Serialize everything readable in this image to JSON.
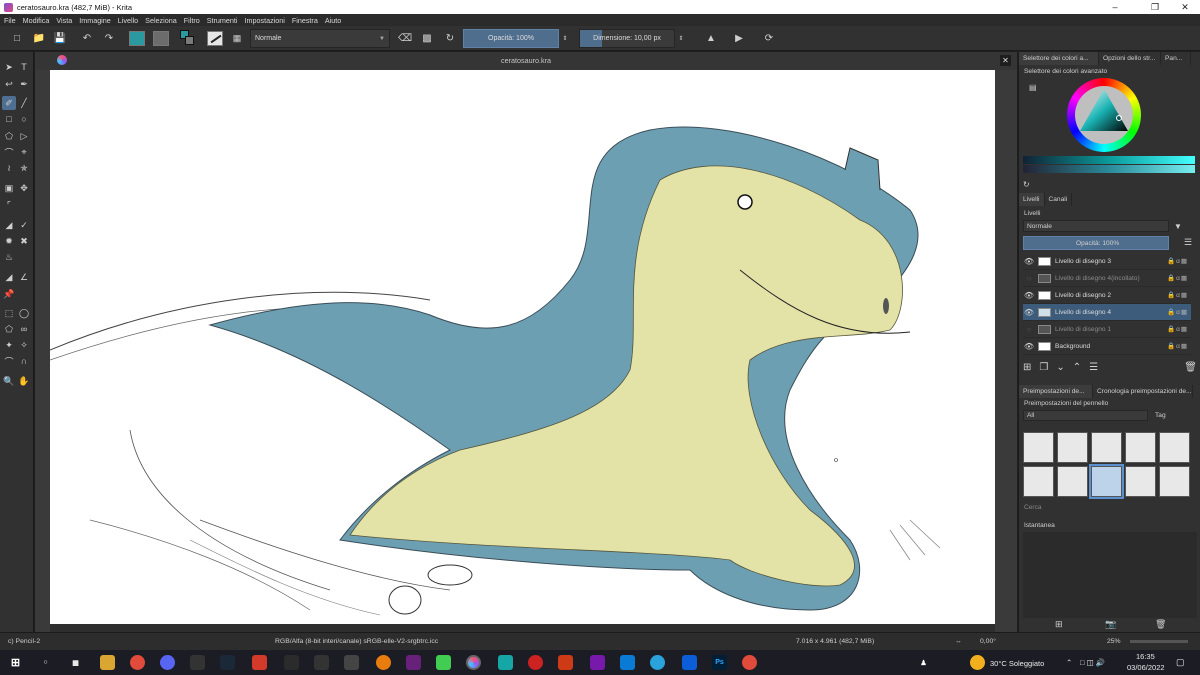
{
  "window": {
    "title": "ceratosauro.kra (482,7 MiB)  - Krita"
  },
  "menu": [
    "File",
    "Modifica",
    "Vista",
    "Immagine",
    "Livello",
    "Seleziona",
    "Filtro",
    "Strumenti",
    "Impostazioni",
    "Finestra",
    "Aiuto"
  ],
  "toolbar": {
    "blend_mode": "Normale",
    "opacity": "Opacità: 100%",
    "size": "Dimensione: 10,00 px",
    "fg_color": "#2b9aa0",
    "bg_color": "#7a7a7a"
  },
  "document": {
    "tab_title": "ceratosauro.kra"
  },
  "docker": {
    "color_tabs": [
      "Selettore dei colori a...",
      "Opzioni dello str...",
      "Pan..."
    ],
    "color_selector_label": "Selettore dei colori avanzato",
    "layer_tabs": [
      "Livelli",
      "Canali"
    ],
    "layers_title": "Livelli",
    "layer_blend": "Normale",
    "layer_opacity": "Opacità:  100%",
    "layers": [
      {
        "name": "Livello di disegno 3",
        "visible": true,
        "selected": false
      },
      {
        "name": "Livello di disegno 4(incollato)",
        "visible": false,
        "selected": false
      },
      {
        "name": "Livello di disegno 2",
        "visible": true,
        "selected": false
      },
      {
        "name": "Livello di disegno 4",
        "visible": true,
        "selected": true
      },
      {
        "name": "Livello di disegno 1",
        "visible": false,
        "selected": false
      },
      {
        "name": "Background",
        "visible": true,
        "selected": false
      }
    ],
    "preset_tabs": [
      "Preimpostazioni de...",
      "Cronologia preimpostazioni de..."
    ],
    "presets_title": "Preimpostazioni del pennello",
    "preset_filter": "All",
    "tag_label": "Tag",
    "search_placeholder": "Cerca",
    "snapshot_title": "Istantanea"
  },
  "status": {
    "brush": "c) Pencil-2",
    "colorspace": "RGB/Alfa (8-bit interi/canale)  sRGB-elle-V2-srgbtrc.icc",
    "dimensions": "7.016 x 4.961 (482,7 MiB)",
    "rotation": "0,00°",
    "zoom": "25%"
  },
  "taskbar": {
    "temperature": "30°C  Soleggiato",
    "time": "16:35",
    "date": "03/06/2022"
  }
}
